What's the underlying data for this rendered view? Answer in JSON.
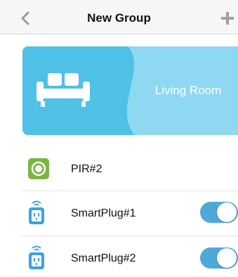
{
  "header": {
    "title": "New Group",
    "back_icon": "chevron-left-icon",
    "add_icon": "plus-icon"
  },
  "room": {
    "label": "Living Room",
    "icon": "sofa-icon",
    "colors": {
      "left": "#4fc0e6",
      "right": "#8fd8f2"
    }
  },
  "devices": [
    {
      "name": "PIR#2",
      "icon": "motion-sensor-icon",
      "has_toggle": false
    },
    {
      "name": "SmartPlug#1",
      "icon": "smart-plug-icon",
      "has_toggle": true,
      "toggle_on": true
    },
    {
      "name": "SmartPlug#2",
      "icon": "smart-plug-icon",
      "has_toggle": true,
      "toggle_on": true
    }
  ],
  "colors": {
    "accent": "#4ea9d8",
    "sensor_green": "#7bb542",
    "navbar": "#f6f6f6"
  }
}
